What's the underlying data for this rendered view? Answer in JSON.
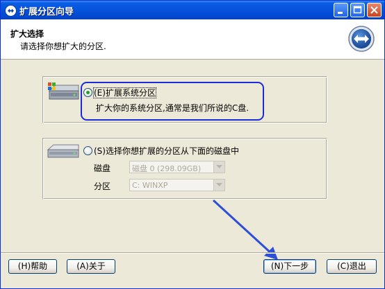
{
  "window": {
    "title": "扩展分区向导"
  },
  "header": {
    "title": "扩大选择",
    "subtitle": "请选择你想扩大的分区."
  },
  "options": [
    {
      "label": "(E)扩展系统分区",
      "description": "扩大你的系统分区,通常是我们所说的C盘.",
      "selected": true
    },
    {
      "label": "(S)选择你想扩展的分区从下面的磁盘中",
      "selected": false,
      "fields": [
        {
          "label": "磁盘",
          "value": "磁盘 0 (298.09GB)"
        },
        {
          "label": "分区",
          "value": "C: WINXP"
        }
      ]
    }
  ],
  "buttons": {
    "help": "(H)帮助",
    "about": "(A)关于",
    "next": "(N)下一步",
    "exit": "(C)退出"
  },
  "colors": {
    "highlight_border": "#1b2bd6",
    "titlebar": "#0553dc",
    "background": "#ece9d8"
  }
}
